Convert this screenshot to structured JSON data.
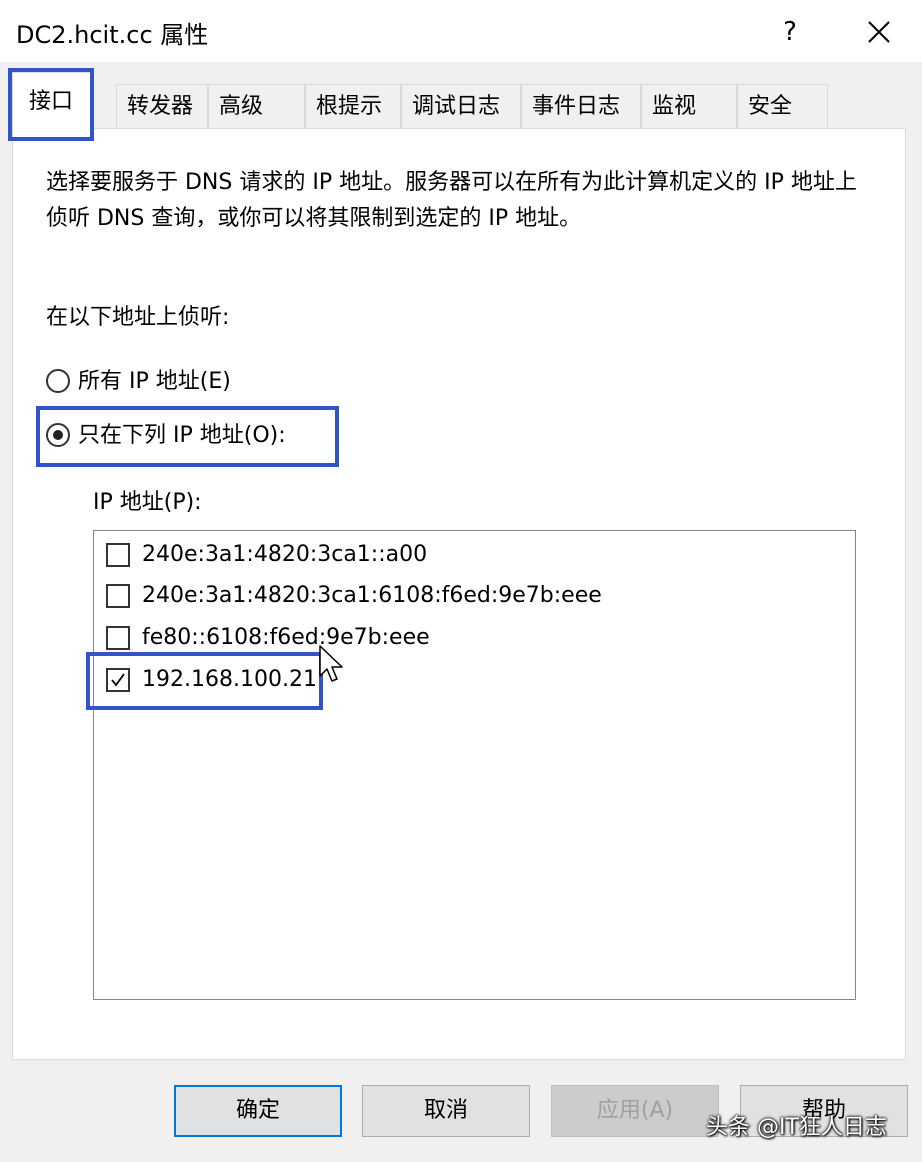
{
  "window": {
    "title": "DC2.hcit.cc 属性",
    "help_label": "?"
  },
  "tabs": [
    {
      "label": "接口",
      "active": true
    },
    {
      "label": "转发器"
    },
    {
      "label": "高级"
    },
    {
      "label": "根提示"
    },
    {
      "label": "调试日志"
    },
    {
      "label": "事件日志"
    },
    {
      "label": "监视"
    },
    {
      "label": "安全"
    }
  ],
  "interfaces": {
    "description": "选择要服务于 DNS 请求的 IP 地址。服务器可以在所有为此计算机定义的 IP 地址上侦听 DNS 查询，或你可以将其限制到选定的 IP 地址。",
    "listen_label": "在以下地址上侦听:",
    "radio_all": {
      "label": "所有 IP 地址(E)",
      "selected": false
    },
    "radio_only": {
      "label": "只在下列 IP 地址(O):",
      "selected": true
    },
    "ip_list_label": "IP 地址(P):",
    "ip_addresses": [
      {
        "address": "240e:3a1:4820:3ca1::a00",
        "checked": false
      },
      {
        "address": "240e:3a1:4820:3ca1:6108:f6ed:9e7b:eee",
        "checked": false
      },
      {
        "address": "fe80::6108:f6ed:9e7b:eee",
        "checked": false
      },
      {
        "address": "192.168.100.21",
        "checked": true
      }
    ]
  },
  "buttons": {
    "ok": "确定",
    "cancel": "取消",
    "apply": "应用(A)",
    "help": "帮助"
  },
  "watermark": "头条 @IT狂人日志",
  "colors": {
    "highlight": "#2f55c8",
    "default_button_border": "#0078d7",
    "background": "#f0f0f0"
  }
}
